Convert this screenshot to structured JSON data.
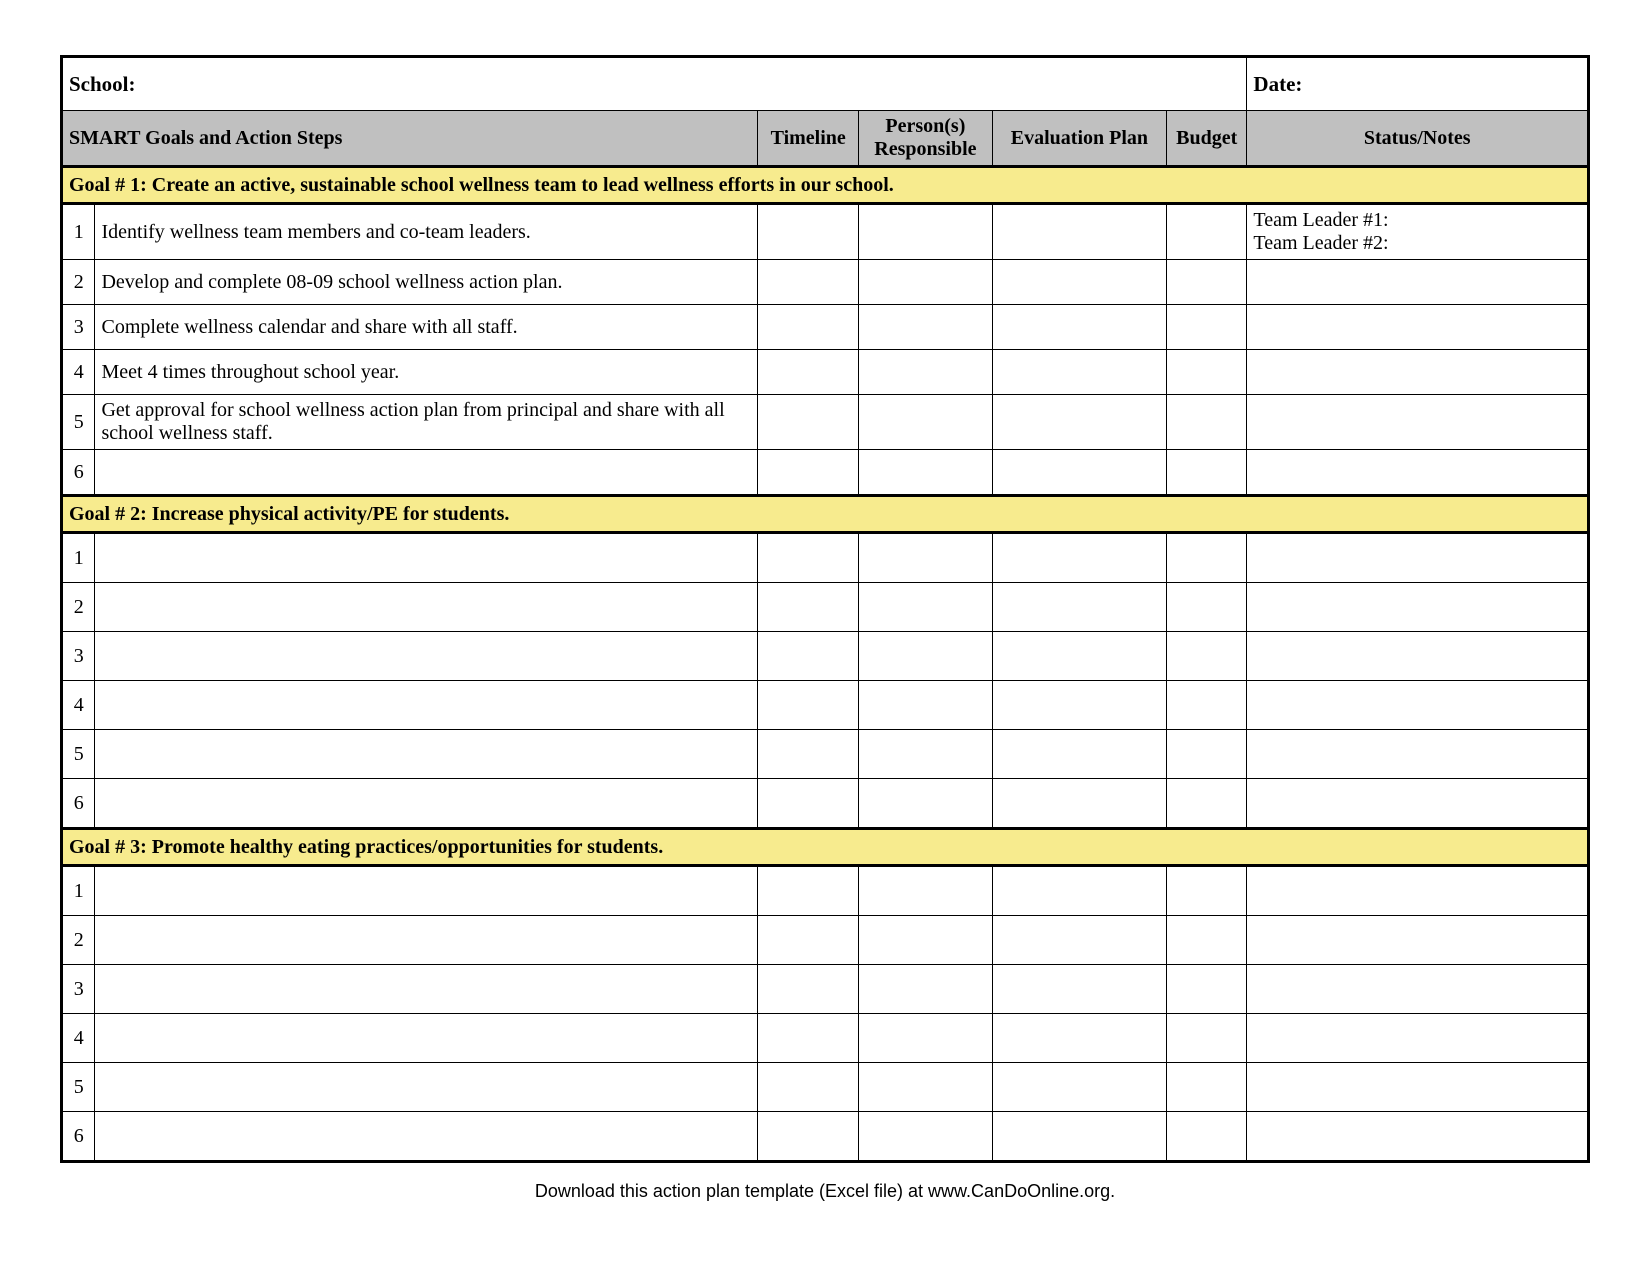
{
  "meta": {
    "school_label": "School:",
    "date_label": "Date:"
  },
  "columns": {
    "steps": "SMART Goals and Action Steps",
    "timeline": "Timeline",
    "person": "Person(s) Responsible",
    "eval": "Evaluation Plan",
    "budget": "Budget",
    "status": "Status/Notes"
  },
  "goals": [
    {
      "title": "Goal # 1: Create an active, sustainable school wellness team to lead wellness efforts in our school.",
      "steps": [
        {
          "n": "1",
          "desc": "Identify wellness team members and co-team leaders.",
          "timeline": "",
          "person": "",
          "eval": "",
          "budget": "",
          "status": "Team Leader #1:\nTeam Leader #2:"
        },
        {
          "n": "2",
          "desc": "Develop and complete 08-09 school wellness action plan.",
          "timeline": "",
          "person": "",
          "eval": "",
          "budget": "",
          "status": ""
        },
        {
          "n": "3",
          "desc": "Complete wellness calendar and share with all staff.",
          "timeline": "",
          "person": "",
          "eval": "",
          "budget": "",
          "status": ""
        },
        {
          "n": "4",
          "desc": "Meet 4 times throughout school year.",
          "timeline": "",
          "person": "",
          "eval": "",
          "budget": "",
          "status": ""
        },
        {
          "n": "5",
          "desc": "Get approval for school wellness action plan from principal and share with all school wellness staff.",
          "timeline": "",
          "person": "",
          "eval": "",
          "budget": "",
          "status": ""
        },
        {
          "n": "6",
          "desc": "",
          "timeline": "",
          "person": "",
          "eval": "",
          "budget": "",
          "status": ""
        }
      ]
    },
    {
      "title": "Goal # 2: Increase physical activity/PE for students.",
      "steps": [
        {
          "n": "1",
          "desc": "",
          "timeline": "",
          "person": "",
          "eval": "",
          "budget": "",
          "status": ""
        },
        {
          "n": "2",
          "desc": "",
          "timeline": "",
          "person": "",
          "eval": "",
          "budget": "",
          "status": ""
        },
        {
          "n": "3",
          "desc": "",
          "timeline": "",
          "person": "",
          "eval": "",
          "budget": "",
          "status": ""
        },
        {
          "n": "4",
          "desc": "",
          "timeline": "",
          "person": "",
          "eval": "",
          "budget": "",
          "status": ""
        },
        {
          "n": "5",
          "desc": "",
          "timeline": "",
          "person": "",
          "eval": "",
          "budget": "",
          "status": ""
        },
        {
          "n": "6",
          "desc": "",
          "timeline": "",
          "person": "",
          "eval": "",
          "budget": "",
          "status": ""
        }
      ]
    },
    {
      "title": "Goal # 3: Promote healthy eating practices/opportunities for students.",
      "steps": [
        {
          "n": "1",
          "desc": "",
          "timeline": "",
          "person": "",
          "eval": "",
          "budget": "",
          "status": ""
        },
        {
          "n": "2",
          "desc": "",
          "timeline": "",
          "person": "",
          "eval": "",
          "budget": "",
          "status": ""
        },
        {
          "n": "3",
          "desc": "",
          "timeline": "",
          "person": "",
          "eval": "",
          "budget": "",
          "status": ""
        },
        {
          "n": "4",
          "desc": "",
          "timeline": "",
          "person": "",
          "eval": "",
          "budget": "",
          "status": ""
        },
        {
          "n": "5",
          "desc": "",
          "timeline": "",
          "person": "",
          "eval": "",
          "budget": "",
          "status": ""
        },
        {
          "n": "6",
          "desc": "",
          "timeline": "",
          "person": "",
          "eval": "",
          "budget": "",
          "status": ""
        }
      ]
    }
  ],
  "footer": "Download this action plan template (Excel file) at www.CanDoOnline.org."
}
